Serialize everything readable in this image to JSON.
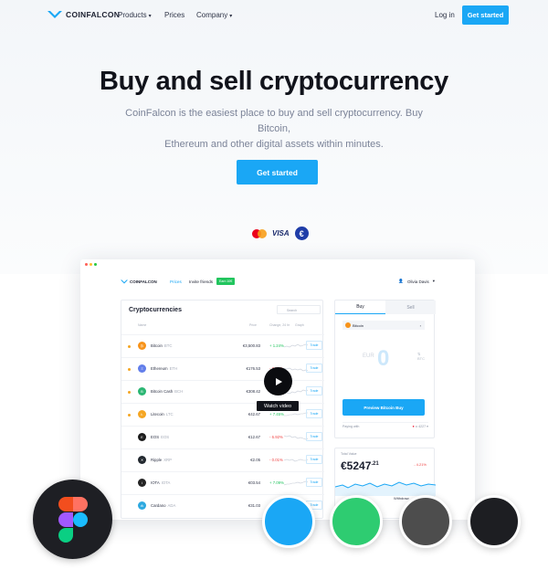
{
  "brand": {
    "name": "COINFALCON",
    "accent": "#1aa7f5"
  },
  "nav": {
    "products": "Products",
    "prices": "Prices",
    "company": "Company",
    "login": "Log in",
    "get_started": "Get started"
  },
  "hero": {
    "title": "Buy and sell cryptocurrency",
    "subtitle_line1": "CoinFalcon is the easiest place to buy and sell cryptocurrency. Buy Bitcoin,",
    "subtitle_line2": "Ethereum and other digital assets within minutes.",
    "cta": "Get started"
  },
  "payment": {
    "visa": "VISA",
    "euro": "€"
  },
  "app": {
    "logo": "COINFALCON",
    "nav": {
      "prices": "Prices",
      "invite": "Invite friends",
      "badge": "Earn 10€",
      "user": "Olivia Davis"
    },
    "table": {
      "title": "Cryptocurrencies",
      "search_placeholder": "Search",
      "headers": [
        "Name",
        "Price",
        "Change, 24 hr",
        "Graph"
      ],
      "rows": [
        {
          "name": "Bitcoin",
          "sym": "BTC",
          "price": "€3,500.83",
          "change": "+ 1.24%",
          "dir": "up",
          "color": "#f7931a",
          "glyph": "₿",
          "trade": "Trade"
        },
        {
          "name": "Ethereum",
          "sym": "ETH",
          "price": "€176.53",
          "change": "- 3.89%",
          "dir": "down",
          "color": "#627eea",
          "glyph": "Ξ",
          "trade": "Trade"
        },
        {
          "name": "Bitcoin Cash",
          "sym": "BCH",
          "price": "€308.42",
          "change": "+ 4.36%",
          "dir": "up",
          "color": "#2bb673",
          "glyph": "B",
          "trade": "Trade"
        },
        {
          "name": "Litecoin",
          "sym": "LTC",
          "price": "€42.67",
          "change": "+ 7.45%",
          "dir": "up",
          "color": "#f5a623",
          "glyph": "Ł",
          "trade": "Trade"
        },
        {
          "name": "EOS",
          "sym": "EOS",
          "price": "€12.67",
          "change": "- 6.92%",
          "dir": "down",
          "color": "#1c1c1c",
          "glyph": "E",
          "trade": "Trade"
        },
        {
          "name": "Ripple",
          "sym": "XRP",
          "price": "€2.05",
          "change": "- 0.01%",
          "dir": "down",
          "color": "#23292f",
          "glyph": "✕",
          "trade": "Trade"
        },
        {
          "name": "IOTA",
          "sym": "IOTA",
          "price": "€03.54",
          "change": "+ 7.09%",
          "dir": "up",
          "color": "#242424",
          "glyph": "i",
          "trade": "Trade"
        },
        {
          "name": "Cardano",
          "sym": "ADA",
          "price": "€31.03",
          "change": "+ 13.49%",
          "dir": "up",
          "color": "#2ea9e0",
          "glyph": "₳",
          "trade": "Trade"
        }
      ]
    },
    "buy": {
      "tab_buy": "Buy",
      "tab_sell": "Sell",
      "asset": "Bitcoin",
      "amount": "0",
      "currency": "EUR",
      "swap": "BTC",
      "preview": "Preview Bitcoin Buy",
      "paying_label": "Paying with",
      "paying_value": "•• 4227"
    },
    "value": {
      "label": "Total Value",
      "amount": "€5247",
      "cents": ".21",
      "change": "- 4.21%",
      "withdraw": "Withdraw"
    },
    "video": {
      "label": "Watch video"
    }
  },
  "swatches": [
    "#1aa7f5",
    "#2ecc71",
    "#4d4d4d",
    "#1d1e22"
  ]
}
